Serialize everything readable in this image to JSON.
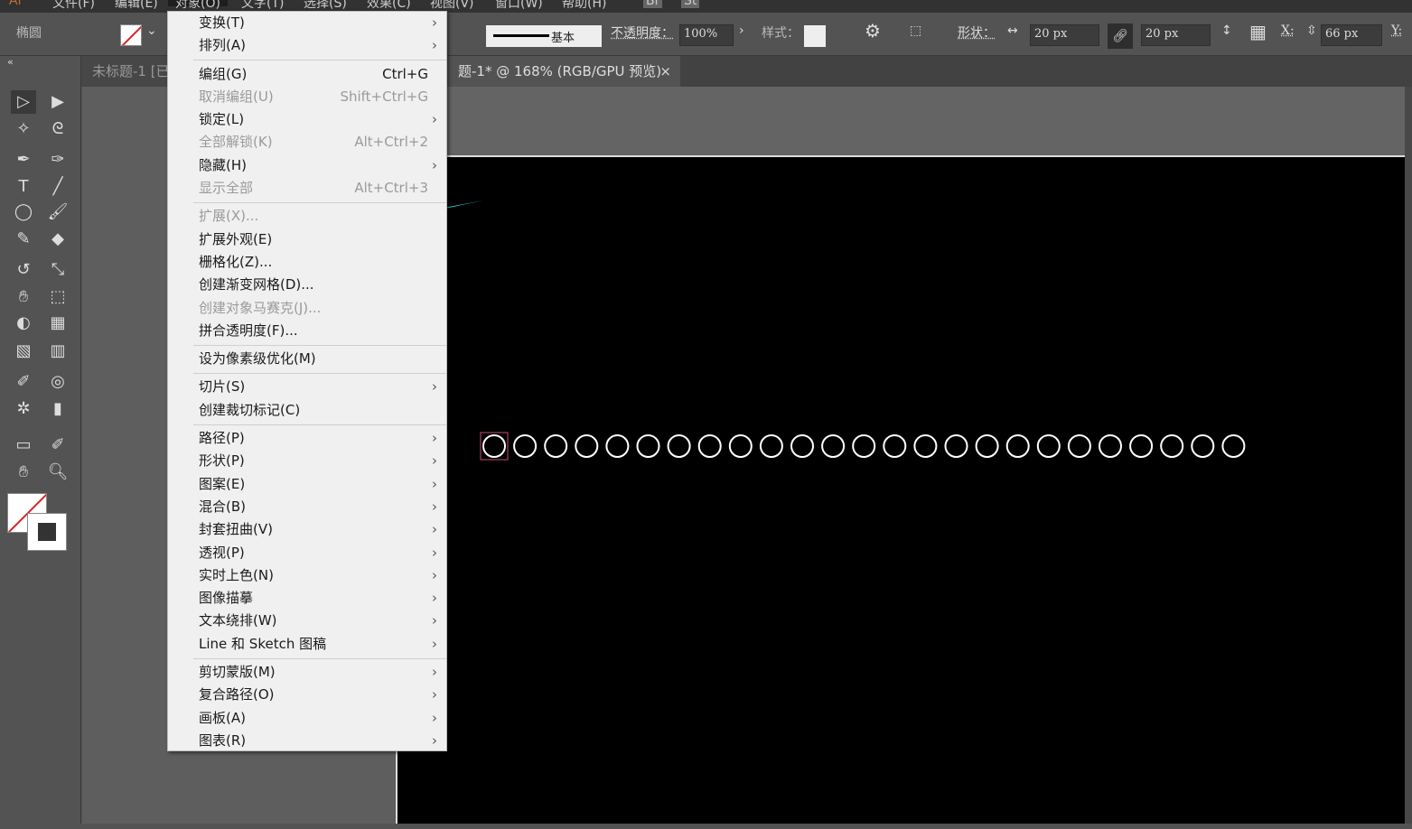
{
  "menubar": {
    "logo": "Ai",
    "items": [
      "文件(F)",
      "编辑(E)",
      "对象(O)",
      "文字(T)",
      "选择(S)",
      "效果(C)",
      "视图(V)",
      "窗口(W)",
      "帮助(H)"
    ],
    "active": "对象(O)",
    "extra": [
      "Br",
      "St"
    ]
  },
  "control": {
    "object_type": "椭圆",
    "stroke_style": "基本",
    "opacity_label": "不透明度：",
    "opacity": "100%",
    "style_label": "样式：",
    "shape_label": "形状：",
    "width": "20 px",
    "height": "20 px",
    "x_label": "X:",
    "x": "66 px",
    "y_label": "Y:"
  },
  "tabs": [
    {
      "label": "未标题-1  [已"
    },
    {
      "label": "题-1* @ 168% (RGB/GPU 预览)",
      "close": "×"
    }
  ],
  "menu": {
    "groups": [
      [
        {
          "label": "变换(T)",
          "sub": true
        },
        {
          "label": "排列(A)",
          "sub": true
        }
      ],
      [
        {
          "label": "编组(G)",
          "shortcut": "Ctrl+G"
        },
        {
          "label": "取消编组(U)",
          "shortcut": "Shift+Ctrl+G",
          "disabled": true
        },
        {
          "label": "锁定(L)",
          "sub": true
        },
        {
          "label": "全部解锁(K)",
          "shortcut": "Alt+Ctrl+2",
          "disabled": true
        },
        {
          "label": "隐藏(H)",
          "sub": true
        },
        {
          "label": "显示全部",
          "shortcut": "Alt+Ctrl+3",
          "disabled": true
        }
      ],
      [
        {
          "label": "扩展(X)...",
          "disabled": true
        },
        {
          "label": "扩展外观(E)"
        },
        {
          "label": "栅格化(Z)..."
        },
        {
          "label": "创建渐变网格(D)..."
        },
        {
          "label": "创建对象马赛克(J)...",
          "disabled": true
        },
        {
          "label": "拼合透明度(F)..."
        }
      ],
      [
        {
          "label": "设为像素级优化(M)"
        }
      ],
      [
        {
          "label": "切片(S)",
          "sub": true
        },
        {
          "label": "创建裁切标记(C)"
        }
      ],
      [
        {
          "label": "路径(P)",
          "sub": true
        },
        {
          "label": "形状(P)",
          "sub": true
        },
        {
          "label": "图案(E)",
          "sub": true
        },
        {
          "label": "混合(B)",
          "sub": true
        },
        {
          "label": "封套扭曲(V)",
          "sub": true
        },
        {
          "label": "透视(P)",
          "sub": true
        },
        {
          "label": "实时上色(N)",
          "sub": true
        },
        {
          "label": "图像描摹",
          "sub": true
        },
        {
          "label": "文本绕排(W)",
          "sub": true
        },
        {
          "label": "Line 和 Sketch 图稿",
          "sub": true
        }
      ],
      [
        {
          "label": "剪切蒙版(M)",
          "sub": true
        },
        {
          "label": "复合路径(O)",
          "sub": true
        },
        {
          "label": "画板(A)",
          "sub": true
        },
        {
          "label": "图表(R)",
          "sub": true
        }
      ]
    ]
  },
  "canvas": {
    "circle_count": 25,
    "annotation_arrow_color": "#2fd3d8",
    "highlighted_item": "扩展外观(E)"
  },
  "icons": [
    "selection",
    "direct-selection",
    "magic-wand",
    "lasso",
    "pen",
    "curvature",
    "type",
    "line",
    "ellipse",
    "paintbrush",
    "shaper",
    "eraser",
    "rotate",
    "scale",
    "warp",
    "free-transform",
    "shape-builder",
    "perspective",
    "mesh",
    "gradient",
    "eyedropper",
    "blend",
    "symbol-sprayer",
    "graph",
    "artboard",
    "slice",
    "hand",
    "zoom"
  ]
}
